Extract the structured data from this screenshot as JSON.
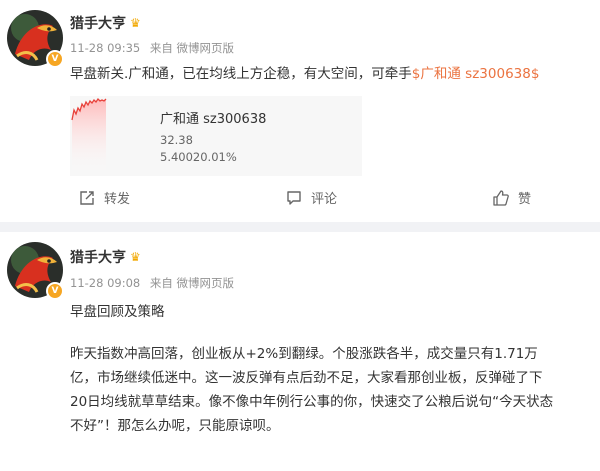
{
  "posts": [
    {
      "username": "猎手大亨",
      "time": "11-28 09:35",
      "source": "来自 微博网页版",
      "text_before": "早盘新关.广和通，已在均线上方企稳，有大空间，可牵手",
      "stock_tag": "$广和通 sz300638$",
      "stock_card": {
        "name": "广和通 sz300638",
        "price": "32.38",
        "change": "5.40020.01%"
      },
      "actions": {
        "repost": "转发",
        "comment": "评论",
        "like": "赞"
      }
    },
    {
      "username": "猎手大亨",
      "time": "11-28 09:08",
      "source": "来自 微博网页版",
      "title": "早盘回顾及策略",
      "body_lines": [
        "昨天指数冲高回落，创业板从+2%到翻绿。个股涨跌各半，成交量只有1.71万",
        "亿，市场继续低迷中。这一波反弹有点后劲不足，大家看那创业板，反弹碰了下",
        "20日均线就草草结束。像不像中年例行公事的你，快速交了公粮后说句“今天状态",
        "不好”！那怎么办呢，只能原谅呗。"
      ]
    }
  ],
  "colors": {
    "tag": "#eb7340",
    "meta": "#939393",
    "badge": "#f6a623"
  },
  "icons": [
    "crown-icon",
    "verified-icon",
    "repost-icon",
    "comment-icon",
    "like-icon"
  ]
}
